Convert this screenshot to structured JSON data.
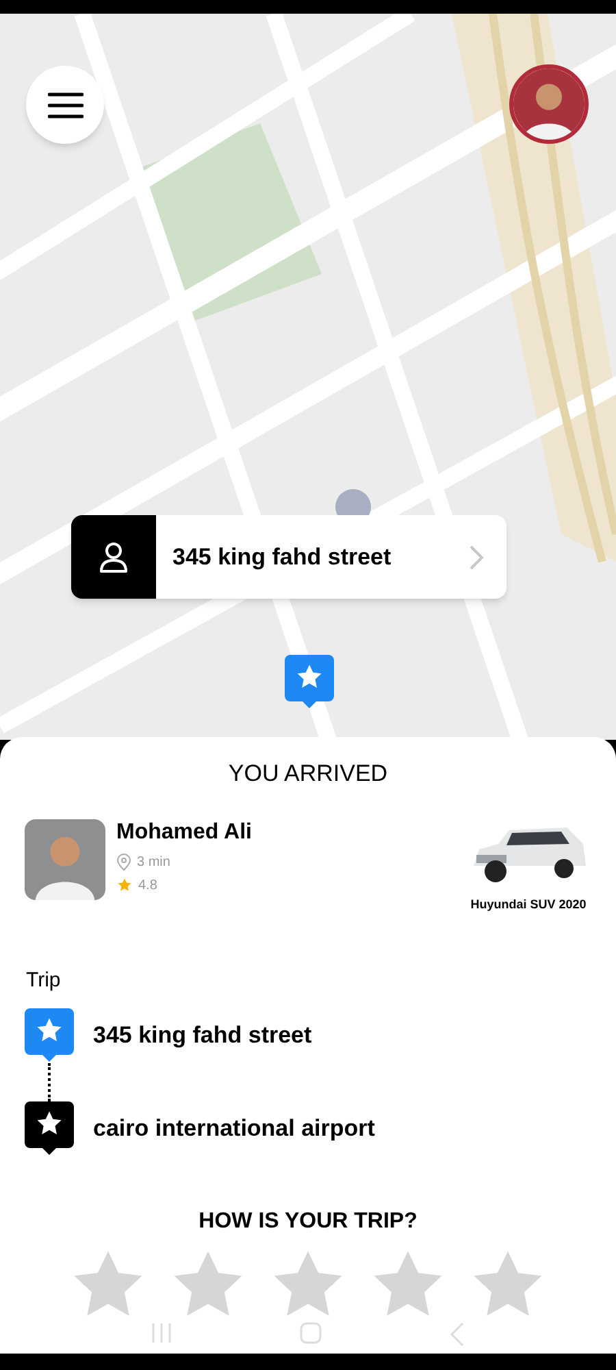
{
  "map": {
    "pickup_callout": {
      "address": "345 king fahd street"
    }
  },
  "arrival": {
    "title": "YOU ARRIVED",
    "driver": {
      "name": "Mohamed Ali",
      "eta": "3 min",
      "rating": "4.8"
    },
    "car": {
      "model": "Huyundai SUV 2020"
    }
  },
  "trip": {
    "label": "Trip",
    "stops": [
      {
        "kind": "pickup",
        "address": "345 king fahd street"
      },
      {
        "kind": "dropoff",
        "address": "cairo international airport"
      }
    ]
  },
  "feedback": {
    "question": "HOW IS YOUR TRIP?",
    "stars": 0
  }
}
